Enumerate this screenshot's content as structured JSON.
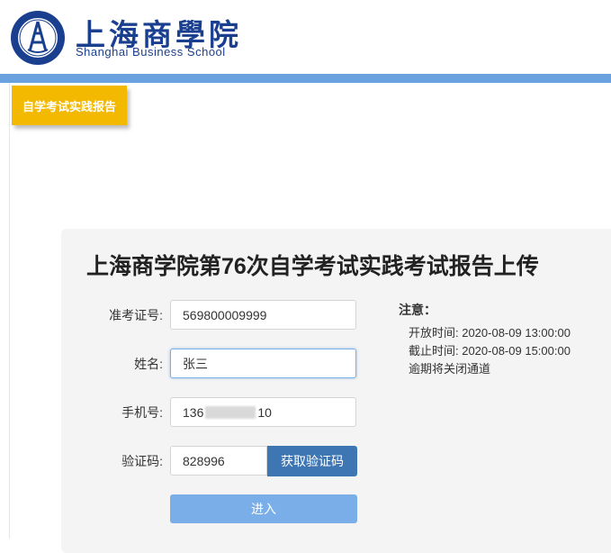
{
  "header": {
    "school_name_cn": "上海商學院",
    "school_name_en": "Shanghai Business School"
  },
  "tag": {
    "label": "自学考试实践报告"
  },
  "form": {
    "title": "上海商学院第76次自学考试实践考试报告上传",
    "exam_id": {
      "label": "准考证号:",
      "value": "569800009999"
    },
    "name": {
      "label": "姓名:",
      "value": "张三"
    },
    "phone": {
      "label": "手机号:",
      "value_prefix": "136",
      "value_suffix": "10"
    },
    "code": {
      "label": "验证码:",
      "value": "828996",
      "button_label": "获取验证码"
    },
    "enter_label": "进入"
  },
  "notice": {
    "title": "注意：",
    "lines": [
      "开放时间: 2020-08-09 13:00:00",
      "截止时间: 2020-08-09 15:00:00",
      "逾期将关闭通道"
    ]
  },
  "colors": {
    "brand_blue": "#1b3f8f",
    "bar_blue": "#6aa2e0",
    "tag_yellow": "#f3b800",
    "button_blue": "#3e76b3"
  }
}
